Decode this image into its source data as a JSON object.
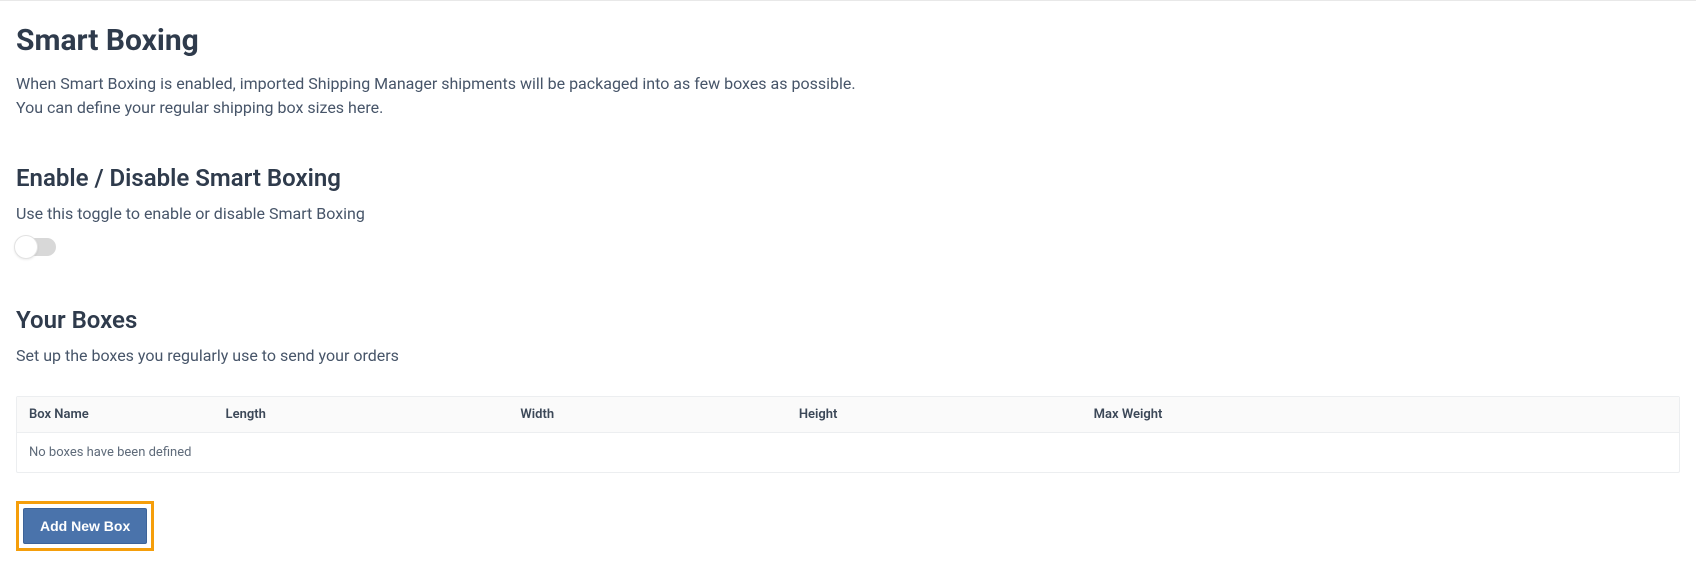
{
  "page": {
    "title": "Smart Boxing",
    "description_line1": "When Smart Boxing is enabled, imported Shipping Manager shipments will be packaged into as few boxes as possible.",
    "description_line2": "You can define your regular shipping box sizes here."
  },
  "enable_section": {
    "title": "Enable / Disable Smart Boxing",
    "description": "Use this toggle to enable or disable Smart Boxing",
    "toggle_state": "off"
  },
  "boxes_section": {
    "title": "Your Boxes",
    "description": "Set up the boxes you regularly use to send your orders",
    "columns": {
      "name": "Box Name",
      "length": "Length",
      "width": "Width",
      "height": "Height",
      "max_weight": "Max Weight"
    },
    "empty_message": "No boxes have been defined",
    "add_button_label": "Add New Box"
  }
}
